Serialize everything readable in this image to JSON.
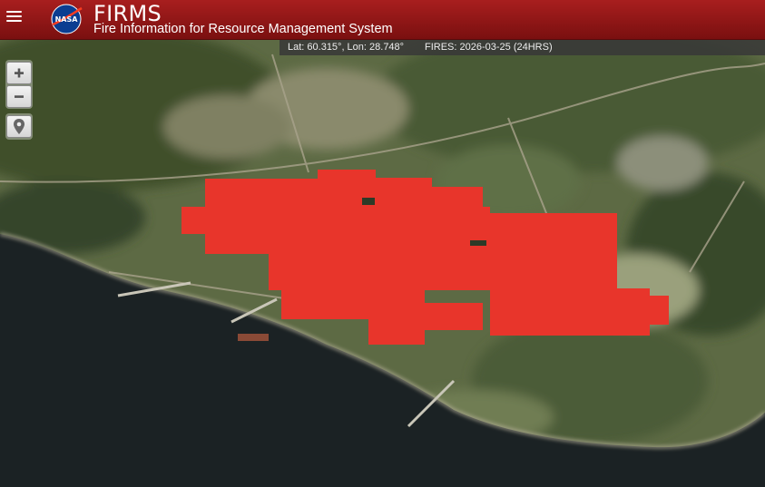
{
  "header": {
    "title": "FIRMS",
    "subtitle": "Fire Information for Resource Management System",
    "logo_text": "NASA"
  },
  "status_bar": {
    "coordinates": "Lat: 60.315°, Lon: 28.748°",
    "fires": "FIRES: 2026-03-25 (24HRS)"
  },
  "controls": {
    "zoom_in": "+",
    "zoom_out": "−",
    "zoom_in_icon": "plus-icon",
    "zoom_out_icon": "minus-icon",
    "locate_icon": "map-pin-icon",
    "menu_icon": "hamburger-menu-icon"
  },
  "map": {
    "type": "satellite imagery",
    "fire_color": "#e8352b",
    "header_color": "#9b1818"
  }
}
